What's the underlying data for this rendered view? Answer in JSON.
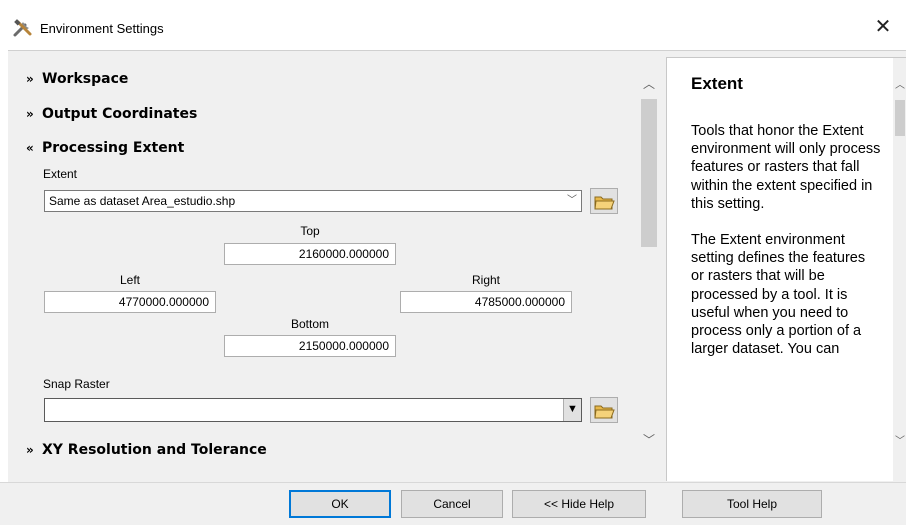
{
  "window": {
    "title": "Environment Settings"
  },
  "sections": {
    "workspace": "Workspace",
    "output_coordinates": "Output Coordinates",
    "processing_extent": "Processing Extent",
    "xy_resolution": "XY Resolution and Tolerance"
  },
  "extent": {
    "label": "Extent",
    "value": "Same as dataset Area_estudio.shp",
    "top_label": "Top",
    "top_value": "2160000.000000",
    "left_label": "Left",
    "left_value": "4770000.000000",
    "right_label": "Right",
    "right_value": "4785000.000000",
    "bottom_label": "Bottom",
    "bottom_value": "2150000.000000"
  },
  "snap_raster": {
    "label": "Snap Raster",
    "value": ""
  },
  "help": {
    "title": "Extent",
    "para1": "Tools that honor the Extent environment will only process features or rasters that fall within the extent specified in this setting.",
    "para2": "The Extent environment setting defines the features or rasters that will be processed by a tool. It is useful when you need to process only a portion of a larger dataset. You can"
  },
  "buttons": {
    "ok": "OK",
    "cancel": "Cancel",
    "hide_help": "<< Hide Help",
    "tool_help": "Tool Help"
  }
}
